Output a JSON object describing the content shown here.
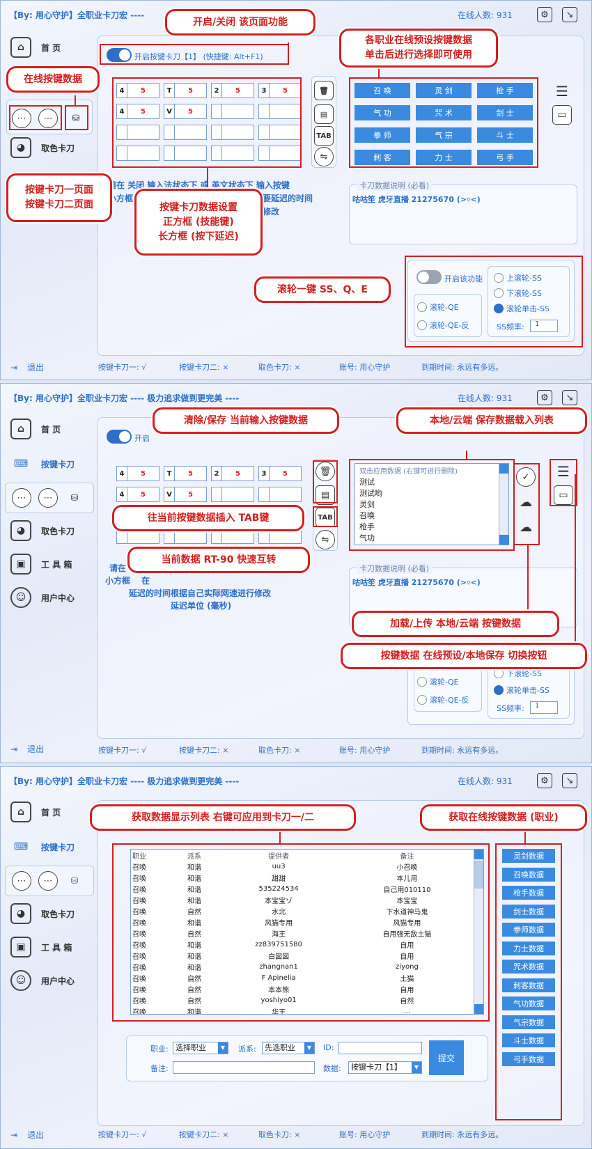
{
  "app": {
    "title": "【By: 用心守护】全职业卡刀宏 ----",
    "title_full": "【By: 用心守护】全职业卡刀宏 ---- 极力追求做到更完美 ----",
    "online": "在线人数: 931",
    "accent": "#2d6fc7"
  },
  "nav": {
    "home": "首  页",
    "keycard": "按键卡刀",
    "color": "取色卡刀",
    "toolbox": "工 具 箱",
    "user": "用户中心",
    "exit": "退出"
  },
  "panel1": {
    "toggle_label": "开启按键卡刀【1】 (快捷键: Alt+F1)",
    "keys": [
      {
        "k": "4",
        "d": "5"
      },
      {
        "k": "T",
        "d": "5"
      },
      {
        "k": "2",
        "d": "5"
      },
      {
        "k": "3",
        "d": "5"
      },
      {
        "k": "4",
        "d": "5"
      },
      {
        "k": "V",
        "d": "5"
      },
      {
        "k": "",
        "d": ""
      },
      {
        "k": "",
        "d": ""
      },
      {
        "k": "",
        "d": ""
      },
      {
        "k": "",
        "d": ""
      },
      {
        "k": "",
        "d": ""
      },
      {
        "k": "",
        "d": ""
      },
      {
        "k": "",
        "d": ""
      },
      {
        "k": "",
        "d": ""
      },
      {
        "k": "",
        "d": ""
      },
      {
        "k": "",
        "d": ""
      }
    ],
    "classes": [
      "召 唤",
      "灵 剑",
      "枪 手",
      "气 功",
      "咒 术",
      "剑 士",
      "拳 师",
      "气 宗",
      "斗 士",
      "刺 客",
      "力 士",
      "弓 手"
    ],
    "hint": "请在 关闭 输入法状态下 或 英文状态下 输入按键",
    "hint2": "小方框",
    "hint3": "需要延迟的时间",
    "hint4": "行修改",
    "note_title": "卡刀数据说明 (必看)",
    "note_text": "咕咕笙 虎牙直播 21275670 (>▿<)",
    "wheel_toggle": "开启该功能",
    "wheel_radios": [
      "滚轮-QE",
      "滚轮-QE-反"
    ],
    "wheel_radios2": [
      "上滚轮-SS",
      "下滚轮-SS",
      "滚轮单击-SS"
    ],
    "ss_label": "SS频率:",
    "ss_value": "1",
    "status": {
      "a": "按键卡刀一: √",
      "b": "按键卡刀二: ×",
      "c": "取色卡刀: ×",
      "d": "账号: 用心守护",
      "e": "到期时间: 永远有多远。"
    },
    "callouts": {
      "c1": "开启/关闭 该页面功能",
      "c2": "各职业在线预设按键数据\n单击后进行选择即可使用",
      "c3": "在线按键数据",
      "c4": "按键卡刀一页面\n按键卡刀二页面",
      "c5": "按键卡刀数据设置\n正方框 (技能键)\n长方框 (按下延迟)",
      "c6": "滚轮一键 SS、Q、E"
    }
  },
  "panel2": {
    "toggle_label": "开启",
    "list_header": "双击应用数据 (右键可进行删除)",
    "list_items": [
      "测试",
      "测试哟",
      "灵剑",
      "召唤",
      "枪手",
      "气功"
    ],
    "hint1": "请在",
    "hint2": "小方框",
    "hint2b": "在",
    "hint3": "延迟的时间根据自己实际网速进行修改",
    "hint4": "延迟单位 (毫秒)",
    "note_title": "卡刀数据说明 (必看)",
    "note_text": "咕咕笙 虎牙直播 21275670 (>▿<)",
    "radios_left": [
      "滚轮-QE",
      "滚轮-QE-反"
    ],
    "radios_right": [
      "下滚轮-SS",
      "滚轮单击-SS"
    ],
    "ss_label": "SS频率:",
    "ss_value": "1",
    "callouts": {
      "c1": "清除/保存 当前输入按键数据",
      "c2": "本地/云端 保存数据载入列表",
      "c3": "往当前按键数据插入 TAB键",
      "c4": "当前数据 RT-90 快速互转",
      "c5": "加载/上传 本地/云端 按键数据",
      "c6": "按键数据 在线预设/本地保存 切换按钮"
    }
  },
  "panel3": {
    "columns": [
      "职业",
      "派系",
      "提供者",
      "备注"
    ],
    "rows": [
      [
        "召唤",
        "和谐",
        "uu3",
        "小召唤"
      ],
      [
        "召唤",
        "和谐",
        "甜甜",
        "本儿用"
      ],
      [
        "召唤",
        "和谐",
        "535224534",
        "自己用010110"
      ],
      [
        "召唤",
        "和谐",
        "本宝宝ゾ",
        "本宝宝"
      ],
      [
        "召唤",
        "自然",
        "水北",
        "下水道神马鬼"
      ],
      [
        "召唤",
        "和谐",
        "风猫专用",
        "风猫专用"
      ],
      [
        "召唤",
        "自然",
        "海王",
        "自用强无敌土猫"
      ],
      [
        "召唤",
        "和谐",
        "zz839751580",
        "自用"
      ],
      [
        "召唤",
        "和谐",
        "白図図",
        "自用"
      ],
      [
        "召唤",
        "和谐",
        "zhangnan1",
        "ziyong"
      ],
      [
        "召唤",
        "自然",
        "F Apinelia",
        "土猫"
      ],
      [
        "召唤",
        "自然",
        "本本熊",
        "自用"
      ],
      [
        "召唤",
        "自然",
        "yoshiyo01",
        "自然"
      ],
      [
        "召唤",
        "和谐",
        "华王",
        "..."
      ]
    ],
    "data_buttons": [
      "灵剑数据",
      "召唤数据",
      "枪手数据",
      "剑士数据",
      "拳师数据",
      "力士数据",
      "咒术数据",
      "刺客数据",
      "气功数据",
      "气宗数据",
      "斗士数据",
      "弓手数据"
    ],
    "form": {
      "class_label": "职业:",
      "class_value": "选择职业",
      "faction_label": "派系:",
      "faction_value": "先选职业",
      "id_label": "ID:",
      "note_label": "备注:",
      "data_label": "数据:",
      "data_value": "按键卡刀【1】",
      "submit": "提交"
    },
    "callouts": {
      "c1": "获取数据显示列表 右键可应用到卡刀一/二",
      "c2": "获取在线按键数据 (职业)"
    }
  }
}
